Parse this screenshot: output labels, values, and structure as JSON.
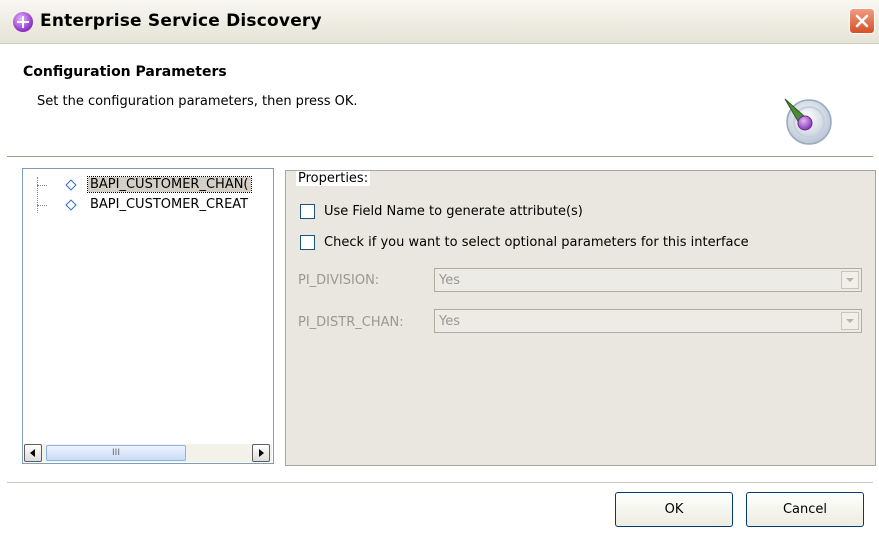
{
  "window": {
    "title": "Enterprise Service Discovery",
    "icon": "enterprise-discovery-icon",
    "close_icon": "close-icon"
  },
  "header": {
    "title": "Configuration Parameters",
    "description": "Set the configuration parameters, then press OK.",
    "icon": "wizard-icon"
  },
  "tree": {
    "items": [
      {
        "label": "BAPI_CUSTOMER_CHAN(",
        "selected": true,
        "icon": "interface-icon"
      },
      {
        "label": "BAPI_CUSTOMER_CREAT",
        "selected": false,
        "icon": "interface-icon"
      }
    ],
    "scrollbar_grip": "III"
  },
  "properties": {
    "legend": "Properties:",
    "checkboxes": [
      {
        "label": "Use Field Name to generate attribute(s)",
        "checked": false
      },
      {
        "label": "Check if you want to select optional parameters for this interface",
        "checked": false
      }
    ],
    "fields": [
      {
        "label": "PI_DIVISION:",
        "value": "Yes",
        "enabled": false
      },
      {
        "label": "PI_DISTR_CHAN:",
        "value": "Yes",
        "enabled": false
      }
    ]
  },
  "buttons": {
    "ok": "OK",
    "cancel": "Cancel"
  }
}
